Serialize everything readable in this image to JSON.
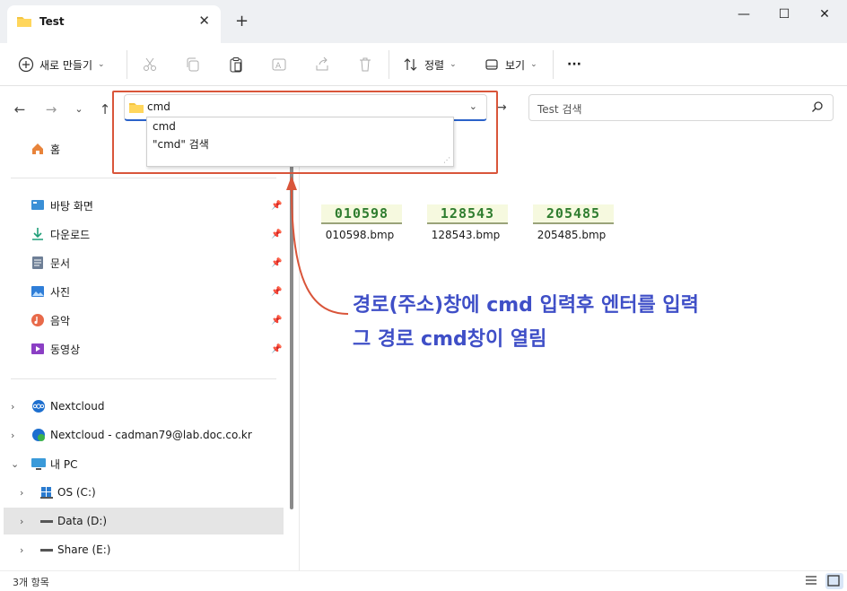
{
  "window": {
    "tab_title": "Test",
    "new_tab": "+",
    "minimize": "—",
    "maximize": "☐",
    "close": "✕"
  },
  "toolbar": {
    "new_label": "새로 만들기",
    "sort_label": "정렬",
    "view_label": "보기",
    "more": "···"
  },
  "address": {
    "value": "cmd",
    "search_placeholder": "Test 검색",
    "suggestions": [
      "cmd",
      "\"cmd\" 검색"
    ]
  },
  "sidebar": {
    "home": "홈",
    "quick": [
      "바탕 화면",
      "다운로드",
      "문서",
      "사진",
      "음악",
      "동영상"
    ],
    "nextcloud": "Nextcloud",
    "nextcloud_user": "Nextcloud - cadman79@lab.doc.co.kr",
    "this_pc": "내 PC",
    "drives": [
      "OS (C:)",
      "Data (D:)",
      "Share (E:)"
    ]
  },
  "files": [
    {
      "thumb_text": "010598",
      "name": "010598.bmp"
    },
    {
      "thumb_text": "128543",
      "name": "128543.bmp"
    },
    {
      "thumb_text": "205485",
      "name": "205485.bmp"
    }
  ],
  "annotation": {
    "line1": "경로(주소)창에 cmd 입력후 엔터를 입력",
    "line2": "그 경로 cmd창이 열림",
    "color": "#3f4fc7",
    "highlight_color": "#d9553a"
  },
  "status": {
    "item_count": "3개 항목"
  }
}
